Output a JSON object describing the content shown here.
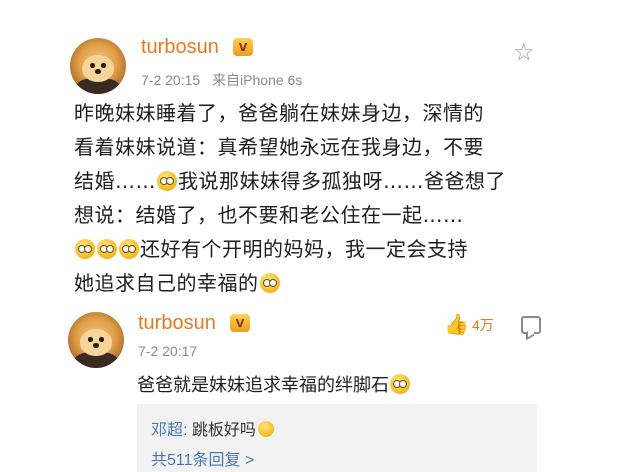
{
  "post": {
    "username": "turbosun",
    "vip_badge": "V",
    "date": "7-2 20:15",
    "source": "来自iPhone 6s",
    "text_line1": "昨晚妹妹睡着了，爸爸躺在妹妹身边，深情的",
    "text_line2": "看着妹妹说道：真希望她永远在我身边，不要",
    "text_line3a": "结婚……",
    "text_line3b": "我说那妹妹得多孤独呀……爸爸想了",
    "text_line4": "想说：结婚了，也不要和老公住在一起……",
    "text_line5": "还好有个开明的妈妈，我一定会支持",
    "text_line6": "她追求自己的幸福的",
    "favorite_icon": "star-outline-icon"
  },
  "comment": {
    "username": "turbosun",
    "vip_badge": "V",
    "date": "7-2 20:17",
    "like_count": "4万",
    "like_icon": "thumbs-up-icon",
    "reply_icon": "comment-bubble-icon",
    "text": "爸爸就是妹妹追求幸福的绊脚石",
    "replies": {
      "author": "邓超:",
      "content": "跳板好吗",
      "more": "共511条回复 >"
    }
  },
  "colors": {
    "username": "#e8791e",
    "link_blue": "#4a78b0",
    "meta_gray": "#8a8a8a",
    "reply_bg": "#f2f2f2"
  }
}
